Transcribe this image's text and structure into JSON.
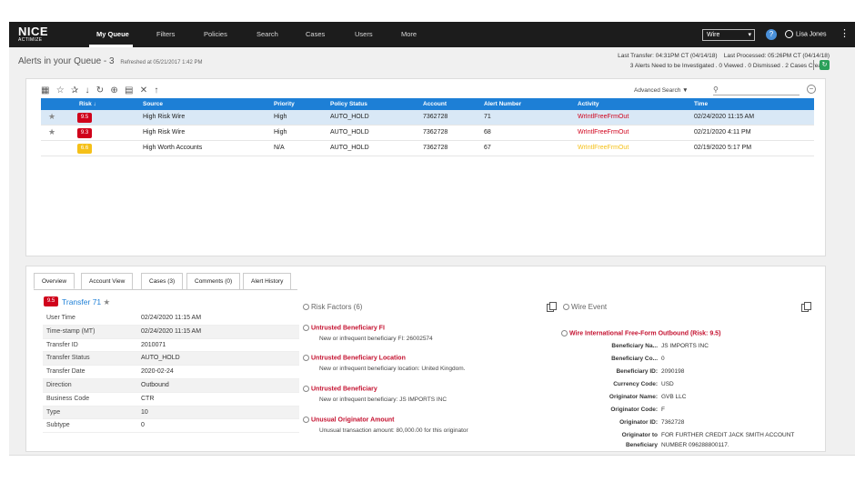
{
  "nav": {
    "logo": "NICE",
    "logo_sub": "ACTIMIZE",
    "items": [
      "My Queue",
      "Filters",
      "Policies",
      "Search",
      "Cases",
      "Users",
      "More"
    ],
    "dropdown_value": "Wire",
    "help": "?",
    "user_name": "Lisa Jones"
  },
  "queue": {
    "title": "Alerts in your Queue - 3",
    "refreshed": "Refreshed at 05/21/2017 1:42 PM",
    "last_transfer": "Last Transfer: 04:31PM CT (04/14/18)",
    "last_processed": "Last Processed: 05:26PM CT (04/14/18)",
    "summary": "3 Alerts Need to be Investigated . 0 Viewed . 0 Dismissed . 2 Cases Created"
  },
  "toolbar": {
    "advanced_search": "Advanced Search"
  },
  "alerts": {
    "columns": [
      "Risk",
      "Source",
      "Priority",
      "Policy Status",
      "Account",
      "Alert Number",
      "Activity",
      "Time"
    ],
    "rows": [
      {
        "starred": true,
        "risk": "9.5",
        "risk_color": "#d0021b",
        "source": "High Risk Wire",
        "priority": "High",
        "policy_status": "AUTO_HOLD",
        "account": "7362728",
        "alert_number": "71",
        "activity": "WrIntlFreeFrmOut",
        "activity_color": "red",
        "time": "02/24/2020 11:15 AM"
      },
      {
        "starred": true,
        "risk": "9.3",
        "risk_color": "#d0021b",
        "source": "High Risk Wire",
        "priority": "High",
        "policy_status": "AUTO_HOLD",
        "account": "7362728",
        "alert_number": "68",
        "activity": "WrIntlFreeFrmOut",
        "activity_color": "red",
        "time": "02/21/2020 4:11 PM"
      },
      {
        "starred": false,
        "risk": "6.6",
        "risk_color": "#f5c018",
        "source": "High Worth Accounts",
        "priority": "N/A",
        "policy_status": "AUTO_HOLD",
        "account": "7362728",
        "alert_number": "67",
        "activity": "WrIntlFreeFrmOut",
        "activity_color": "yellow",
        "time": "02/19/2020 5:17 PM"
      }
    ]
  },
  "detail": {
    "tabs": [
      "Overview",
      "Account View",
      "Cases (3)",
      "Comments (0)",
      "Alert History"
    ],
    "transfer_score": "9.5",
    "transfer_title": "Transfer 71",
    "fields": [
      {
        "k": "User Time",
        "v": "02/24/2020 11:15 AM"
      },
      {
        "k": "Time-stamp (MT)",
        "v": "02/24/2020 11:15 AM"
      },
      {
        "k": "Transfer ID",
        "v": "2010071"
      },
      {
        "k": "Transfer Status",
        "v": "AUTO_HOLD"
      },
      {
        "k": "Transfer Date",
        "v": "2020-02-24"
      },
      {
        "k": "Direction",
        "v": "Outbound"
      },
      {
        "k": "Business Code",
        "v": "CTR"
      },
      {
        "k": "Type",
        "v": "10"
      },
      {
        "k": "Subtype",
        "v": "0"
      }
    ]
  },
  "risk_factors": {
    "title": "Risk Factors (6)",
    "items": [
      {
        "title": "Untrusted Beneficiary FI",
        "desc": "New or infrequent beneficiary FI: 26002574"
      },
      {
        "title": "Untrusted Beneficiary Location",
        "desc": "New or infrequent beneficiary location: United Kingdom."
      },
      {
        "title": "Untrusted Beneficiary",
        "desc": "New or infrequent beneficiary: JS IMPORTS INC"
      },
      {
        "title": "Unusual Originator Amount",
        "desc": "Unusual transaction amount: 80,000.00 for this originator"
      }
    ]
  },
  "wire_event": {
    "title": "Wire Event",
    "subtitle": "Wire International Free-Form Outbound (Risk: 9.5)",
    "fields": [
      {
        "k": "Beneficiary Na...",
        "v": "JS IMPORTS INC"
      },
      {
        "k": "Beneficiary Co...",
        "v": "0"
      },
      {
        "k": "Beneficiary ID:",
        "v": "2090198"
      },
      {
        "k": "Currency Code:",
        "v": "USD"
      },
      {
        "k": "Originator Name:",
        "v": "GVB LLC"
      },
      {
        "k": "Originator Code:",
        "v": "F"
      },
      {
        "k": "Originator ID:",
        "v": "7362728"
      },
      {
        "k": "Originator to",
        "v": "FOR FURTHER CREDIT JACK SMITH ACCOUNT"
      },
      {
        "k": "Beneficiary",
        "v": "NUMBER 096288800117."
      }
    ]
  }
}
